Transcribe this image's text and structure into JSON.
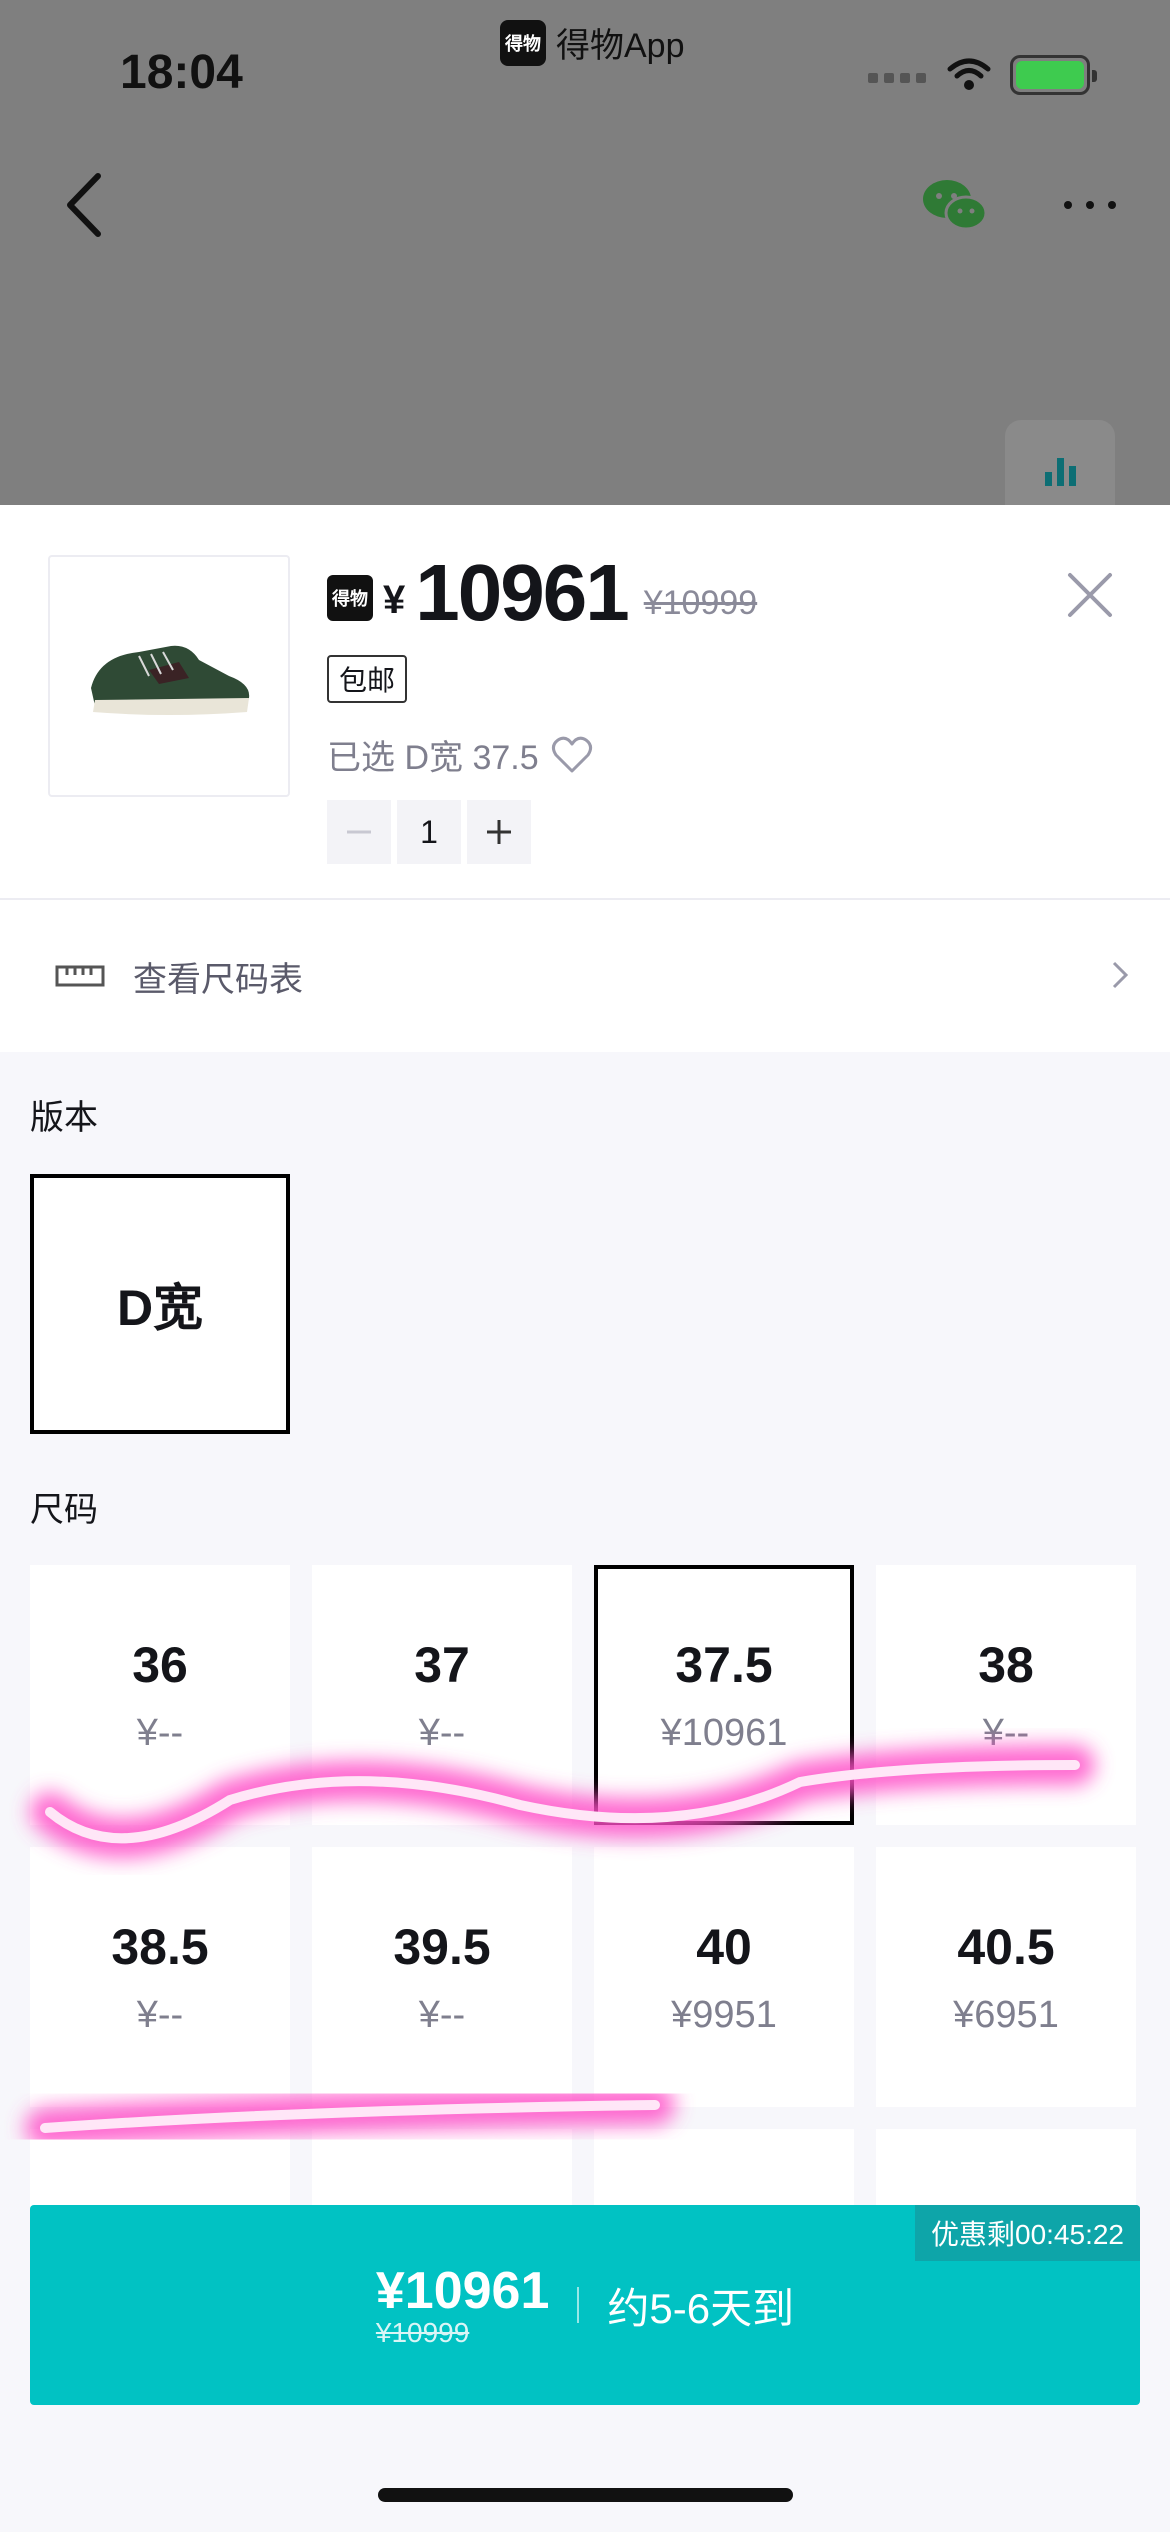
{
  "status": {
    "time": "18:04",
    "app_label": "得物App",
    "app_logo_text": "得物"
  },
  "product": {
    "logo_text": "得物",
    "currency_symbol": "¥",
    "price": "10961",
    "original_price": "¥10999",
    "shipping_badge": "包邮",
    "selected_text": "已选 D宽 37.5",
    "quantity": "1"
  },
  "size_chart": {
    "label": "查看尺码表"
  },
  "version_section": {
    "title": "版本",
    "options": [
      {
        "label": "D宽",
        "selected": true
      }
    ]
  },
  "size_section": {
    "title": "尺码",
    "sizes": [
      {
        "size": "36",
        "price": "¥--"
      },
      {
        "size": "37",
        "price": "¥--"
      },
      {
        "size": "37.5",
        "price": "¥10961",
        "selected": true
      },
      {
        "size": "38",
        "price": "¥--"
      },
      {
        "size": "38.5",
        "price": "¥--"
      },
      {
        "size": "39.5",
        "price": "¥--"
      },
      {
        "size": "40",
        "price": "¥9951"
      },
      {
        "size": "40.5",
        "price": "¥6951"
      }
    ]
  },
  "buy_bar": {
    "price": "¥10961",
    "original_price": "¥10999",
    "eta": "约5-6天到",
    "countdown": "优惠剩00:45:22"
  },
  "colors": {
    "accent": "#01c2c3",
    "highlight": "#ff4fc8"
  }
}
